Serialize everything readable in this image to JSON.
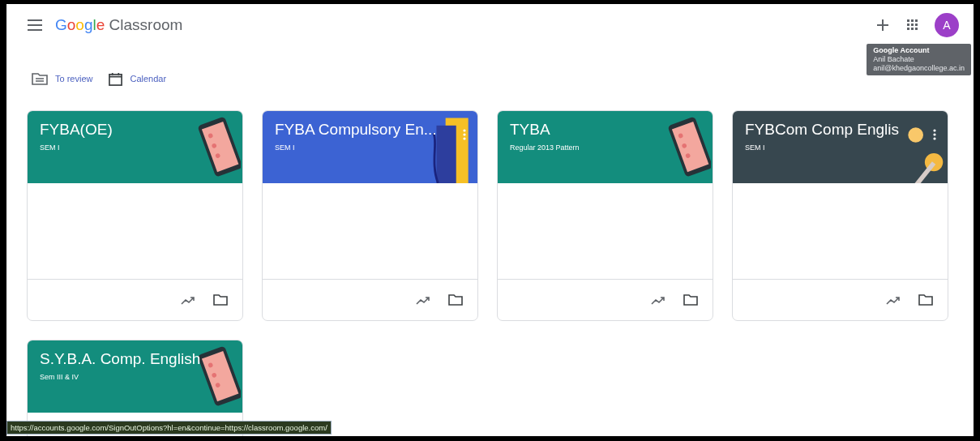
{
  "app_bar": {
    "logo_word": "Google",
    "product": "Classroom",
    "account_initial": "A"
  },
  "account_tooltip": {
    "title": "Google Account",
    "name": "Anil Bachate",
    "email": "anil@khedgaoncollege.ac.in"
  },
  "nav_links": [
    {
      "label": "To review",
      "kind": "review"
    },
    {
      "label": "Calendar",
      "kind": "calendar"
    }
  ],
  "classes": [
    {
      "title": "FYBA(OE)",
      "subtitle": "SEM I",
      "color": "#138d7d",
      "kind": "phone",
      "menu": false
    },
    {
      "title": "FYBA Compulsory En...",
      "subtitle": "SEM I",
      "color": "#3c63d3",
      "kind": "book",
      "menu": true
    },
    {
      "title": "TYBA",
      "subtitle": "Regular 2013 Pattern",
      "color": "#138d7d",
      "kind": "phone",
      "menu": false
    },
    {
      "title": "FYBCom Comp Englis",
      "subtitle": "SEM I",
      "color": "#37474f",
      "kind": "coins",
      "menu": true
    },
    {
      "title": "S.Y.B.A. Comp. English",
      "subtitle": "Sem III & IV",
      "color": "#138d7d",
      "kind": "phone",
      "menu": false
    }
  ],
  "status_bar": {
    "url": "https://accounts.google.com/SignOutOptions?hl=en&continue=https://classroom.google.com/"
  }
}
